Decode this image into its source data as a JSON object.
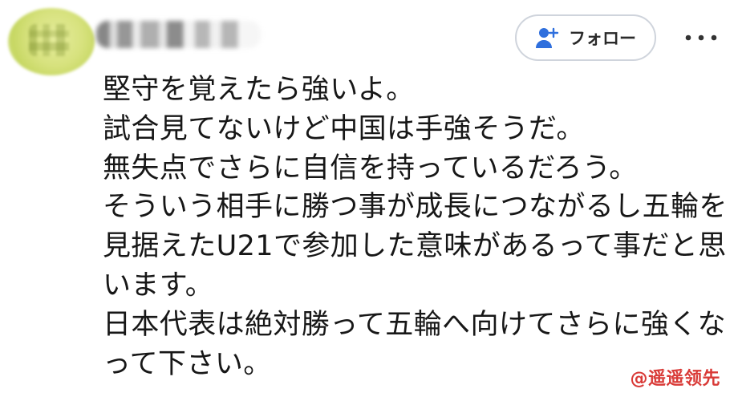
{
  "comment": {
    "follow_label": "フォロー",
    "body_lines": [
      "堅守を覚えたら強いよ。",
      "試合見てないけど中国は手強そうだ。",
      "無失点でさらに自信を持っているだろう。",
      "そういう相手に勝つ事が成長につながるし五輪を",
      "見据えたU21で参加した意味があるって事だと思",
      "います。",
      "日本代表は絶対勝って五輪へ向けてさらに強くな",
      "って下さい。"
    ]
  },
  "watermark": {
    "text": "@遥遥领先"
  },
  "icons": {
    "follow": "person-add-icon",
    "more": "more-horizontal-icon"
  },
  "colors": {
    "follow_icon": "#2f6fdd",
    "watermark": "#d93a37",
    "text": "#171717"
  }
}
